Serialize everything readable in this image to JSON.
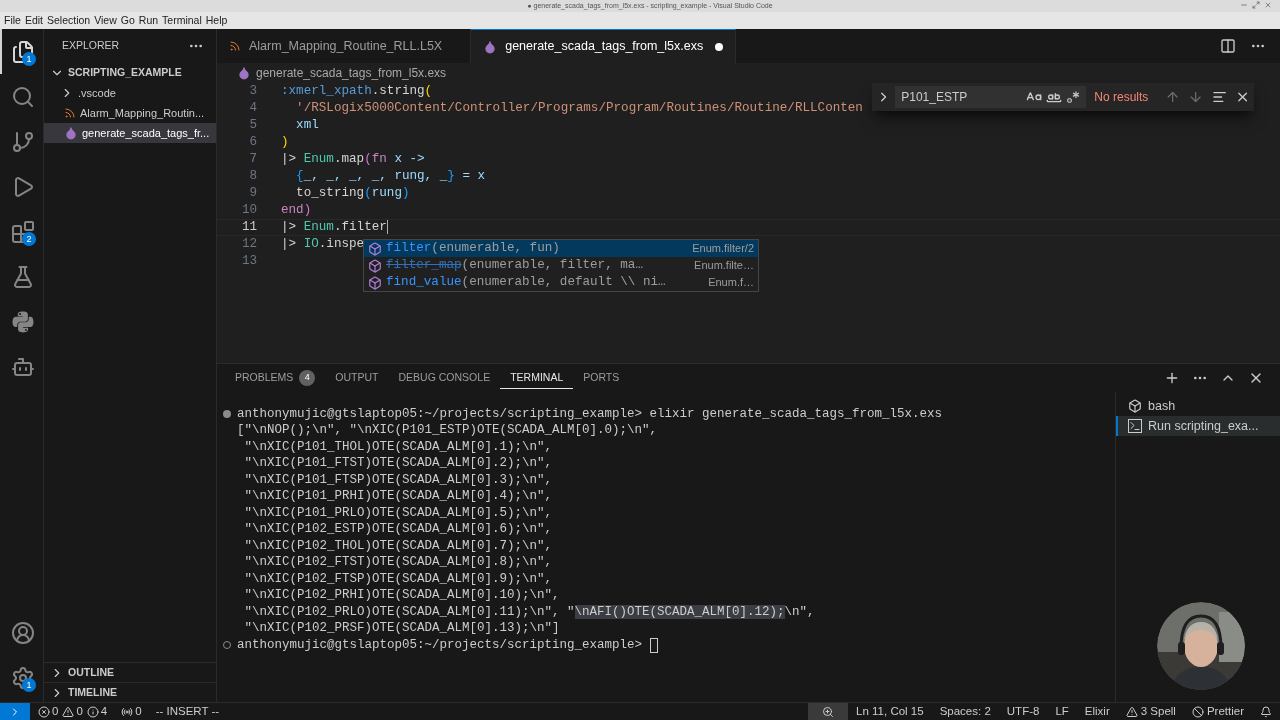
{
  "window": {
    "title": "● generate_scada_tags_from_l5x.exs - scripting_example - Visual Studio Code"
  },
  "menu": [
    "File",
    "Edit",
    "Selection",
    "View",
    "Go",
    "Run",
    "Terminal",
    "Help"
  ],
  "activity_bar": [
    {
      "kind": "files",
      "selected": true,
      "badge": "1"
    },
    {
      "kind": "search",
      "selected": false
    },
    {
      "kind": "source_control",
      "selected": false
    },
    {
      "kind": "run",
      "selected": false
    },
    {
      "kind": "extensions",
      "selected": false,
      "badge": "2"
    },
    {
      "kind": "testing",
      "selected": false
    },
    {
      "kind": "python",
      "selected": false
    },
    {
      "kind": "bot",
      "selected": false
    }
  ],
  "activity_bottom": [
    {
      "kind": "account"
    },
    {
      "kind": "settings",
      "badge": "1"
    }
  ],
  "sidebar": {
    "title": "EXPLORER",
    "folder": "SCRIPTING_EXAMPLE",
    "expanded": true,
    "items": [
      {
        "label": ".vscode",
        "kind": "folder",
        "selected": false
      },
      {
        "label": "Alarm_Mapping_Routin...",
        "kind": "rss",
        "selected": false
      },
      {
        "label": "generate_scada_tags_fr...",
        "kind": "elixir",
        "selected": true
      }
    ],
    "sections": [
      {
        "label": "OUTLINE",
        "expanded": false
      },
      {
        "label": "TIMELINE",
        "expanded": false
      }
    ]
  },
  "tabs": [
    {
      "label": "Alarm_Mapping_Routine_RLL.L5X",
      "kind": "rss",
      "selected": false,
      "modified": false
    },
    {
      "label": "generate_scada_tags_from_l5x.exs",
      "kind": "elixir",
      "selected": true,
      "modified": true
    }
  ],
  "breadcrumb": "generate_scada_tags_from_l5x.exs",
  "code": [
    {
      "number": "3",
      "current": false,
      "segments": [
        {
          "text": ":xmerl_xpath",
          "kind": "atom"
        },
        {
          "text": ".string",
          "kind": "plain"
        },
        {
          "text": "(",
          "kind": "b1"
        }
      ]
    },
    {
      "number": "4",
      "current": false,
      "segments": [
        {
          "text": "  '/RSLogix5000Content/Controller/Programs/Program/Routines/Routine/RLLConten",
          "kind": "string"
        }
      ]
    },
    {
      "number": "5",
      "current": false,
      "segments": [
        {
          "text": "  xml",
          "kind": "var"
        }
      ]
    },
    {
      "number": "6",
      "current": false,
      "segments": [
        {
          "text": ")",
          "kind": "b1"
        }
      ]
    },
    {
      "number": "7",
      "current": false,
      "segments": [
        {
          "text": "|> ",
          "kind": "plain"
        },
        {
          "text": "Enum",
          "kind": "module"
        },
        {
          "text": ".map",
          "kind": "plain"
        },
        {
          "text": "(",
          "kind": "b2"
        },
        {
          "text": "fn",
          "kind": "keyword"
        },
        {
          "text": " x ->",
          "kind": "var"
        }
      ]
    },
    {
      "number": "8",
      "current": false,
      "segments": [
        {
          "text": "  {",
          "kind": "b3"
        },
        {
          "text": "_, _, _, _, rung, _",
          "kind": "var"
        },
        {
          "text": "}",
          "kind": "b3"
        },
        {
          "text": " = x",
          "kind": "var"
        }
      ]
    },
    {
      "number": "9",
      "current": false,
      "segments": [
        {
          "text": "  to_string",
          "kind": "plain"
        },
        {
          "text": "(",
          "kind": "b3"
        },
        {
          "text": "rung",
          "kind": "var"
        },
        {
          "text": ")",
          "kind": "b3"
        }
      ]
    },
    {
      "number": "10",
      "current": false,
      "segments": [
        {
          "text": "end",
          "kind": "keyword"
        },
        {
          "text": ")",
          "kind": "b2"
        }
      ]
    },
    {
      "number": "11",
      "current": true,
      "segments": [
        {
          "text": "|> ",
          "kind": "plain"
        },
        {
          "text": "Enum",
          "kind": "module"
        },
        {
          "text": ".filter",
          "kind": "plain"
        }
      ]
    },
    {
      "number": "12",
      "current": false,
      "segments": [
        {
          "text": "|> ",
          "kind": "plain"
        },
        {
          "text": "IO",
          "kind": "module"
        },
        {
          "text": ".inspe",
          "kind": "plain"
        }
      ]
    },
    {
      "number": "13",
      "current": false
    }
  ],
  "suggestions": [
    {
      "label": "filter",
      "signature": "(enumerable, fun)",
      "detail": "Enum.filter/2",
      "selected": true,
      "deprecated": false
    },
    {
      "label": "filter_map",
      "signature": "(enumerable, filter, ma…",
      "detail": "Enum.filte…",
      "selected": false,
      "deprecated": true
    },
    {
      "label": "find_value",
      "signature": "(enumerable, default \\\\ ni…",
      "detail": "Enum.f…",
      "selected": false,
      "deprecated": false
    }
  ],
  "find": {
    "query": "P101_ESTP",
    "result": "No results"
  },
  "panel_tabs": [
    {
      "label": "PROBLEMS",
      "badge": "4",
      "selected": false
    },
    {
      "label": "OUTPUT",
      "selected": false
    },
    {
      "label": "DEBUG CONSOLE",
      "selected": false
    },
    {
      "label": "TERMINAL",
      "selected": true
    },
    {
      "label": "PORTS",
      "selected": false
    }
  ],
  "terminal": [
    {
      "kind": "prompt",
      "finished": true,
      "segments": [
        {
          "t": "anthonymujic@gtslaptop05:~/projects/scripting_example> elixir generate_scada_tags_from_l5x.exs",
          "highlighted": false
        }
      ]
    },
    {
      "kind": "output",
      "segments": [
        {
          "t": "[\"\\nNOP();\\n\", \"\\nXIC(P101_ESTP)OTE(SCADA_ALM[0].0);\\n\",",
          "highlighted": false
        }
      ]
    },
    {
      "kind": "output",
      "segments": [
        {
          "t": " \"\\nXIC(P101_THOL)OTE(SCADA_ALM[0].1);\\n\",",
          "highlighted": false
        }
      ]
    },
    {
      "kind": "output",
      "segments": [
        {
          "t": " \"\\nXIC(P101_FTST)OTE(SCADA_ALM[0].2);\\n\",",
          "highlighted": false
        }
      ]
    },
    {
      "kind": "output",
      "segments": [
        {
          "t": " \"\\nXIC(P101_FTSP)OTE(SCADA_ALM[0].3);\\n\",",
          "highlighted": false
        }
      ]
    },
    {
      "kind": "output",
      "segments": [
        {
          "t": " \"\\nXIC(P101_PRHI)OTE(SCADA_ALM[0].4);\\n\",",
          "highlighted": false
        }
      ]
    },
    {
      "kind": "output",
      "segments": [
        {
          "t": " \"\\nXIC(P101_PRLO)OTE(SCADA_ALM[0].5);\\n\",",
          "highlighted": false
        }
      ]
    },
    {
      "kind": "output",
      "segments": [
        {
          "t": " \"\\nXIC(P102_ESTP)OTE(SCADA_ALM[0].6);\\n\",",
          "highlighted": false
        }
      ]
    },
    {
      "kind": "output",
      "segments": [
        {
          "t": " \"\\nXIC(P102_THOL)OTE(SCADA_ALM[0].7);\\n\",",
          "highlighted": false
        }
      ]
    },
    {
      "kind": "output",
      "segments": [
        {
          "t": " \"\\nXIC(P102_FTST)OTE(SCADA_ALM[0].8);\\n\",",
          "highlighted": false
        }
      ]
    },
    {
      "kind": "output",
      "segments": [
        {
          "t": " \"\\nXIC(P102_FTSP)OTE(SCADA_ALM[0].9);\\n\",",
          "highlighted": false
        }
      ]
    },
    {
      "kind": "output",
      "segments": [
        {
          "t": " \"\\nXIC(P102_PRHI)OTE(SCADA_ALM[0].10);\\n\",",
          "highlighted": false
        }
      ]
    },
    {
      "kind": "output",
      "segments": [
        {
          "t": " \"\\nXIC(P102_PRLO)OTE(SCADA_ALM[0].11);\\n\", \"",
          "highlighted": false
        },
        {
          "t": "\\nAFI()OTE(SCADA_ALM[0].12);",
          "highlighted": true
        },
        {
          "t": "\\n\",",
          "highlighted": false
        }
      ]
    },
    {
      "kind": "output",
      "segments": [
        {
          "t": " \"\\nXIC(P102_PRSF)OTE(SCADA_ALM[0].13);\\n\"]",
          "highlighted": false
        }
      ]
    },
    {
      "kind": "prompt",
      "finished": false,
      "segments": [
        {
          "t": "anthonymujic@gtslaptop05:~/projects/scripting_example> ",
          "highlighted": false
        }
      ]
    }
  ],
  "terminal_list": [
    {
      "label": "bash",
      "kind": "shell",
      "selected": false
    },
    {
      "label": "Run scripting_exa...",
      "kind": "task",
      "selected": true
    }
  ],
  "webcam": {
    "kind": "picture"
  },
  "status_left": [
    {
      "kind": "errors",
      "text": "0"
    },
    {
      "kind": "warnings",
      "text": "0"
    },
    {
      "kind": "info",
      "text": "4"
    },
    {
      "kind": "ports",
      "text": "0"
    },
    {
      "kind": "mode",
      "text": "-- INSERT --"
    }
  ],
  "status_right": [
    {
      "kind": "zoom"
    },
    {
      "kind": "text",
      "text": "Ln 11, Col 15"
    },
    {
      "kind": "text",
      "text": "Spaces: 2"
    },
    {
      "kind": "text",
      "text": "UTF-8"
    },
    {
      "kind": "text",
      "text": "LF"
    },
    {
      "kind": "text",
      "text": "Elixir"
    },
    {
      "kind": "spell",
      "text": "3 Spell"
    },
    {
      "kind": "prettier",
      "text": "Prettier"
    },
    {
      "kind": "bell"
    }
  ]
}
